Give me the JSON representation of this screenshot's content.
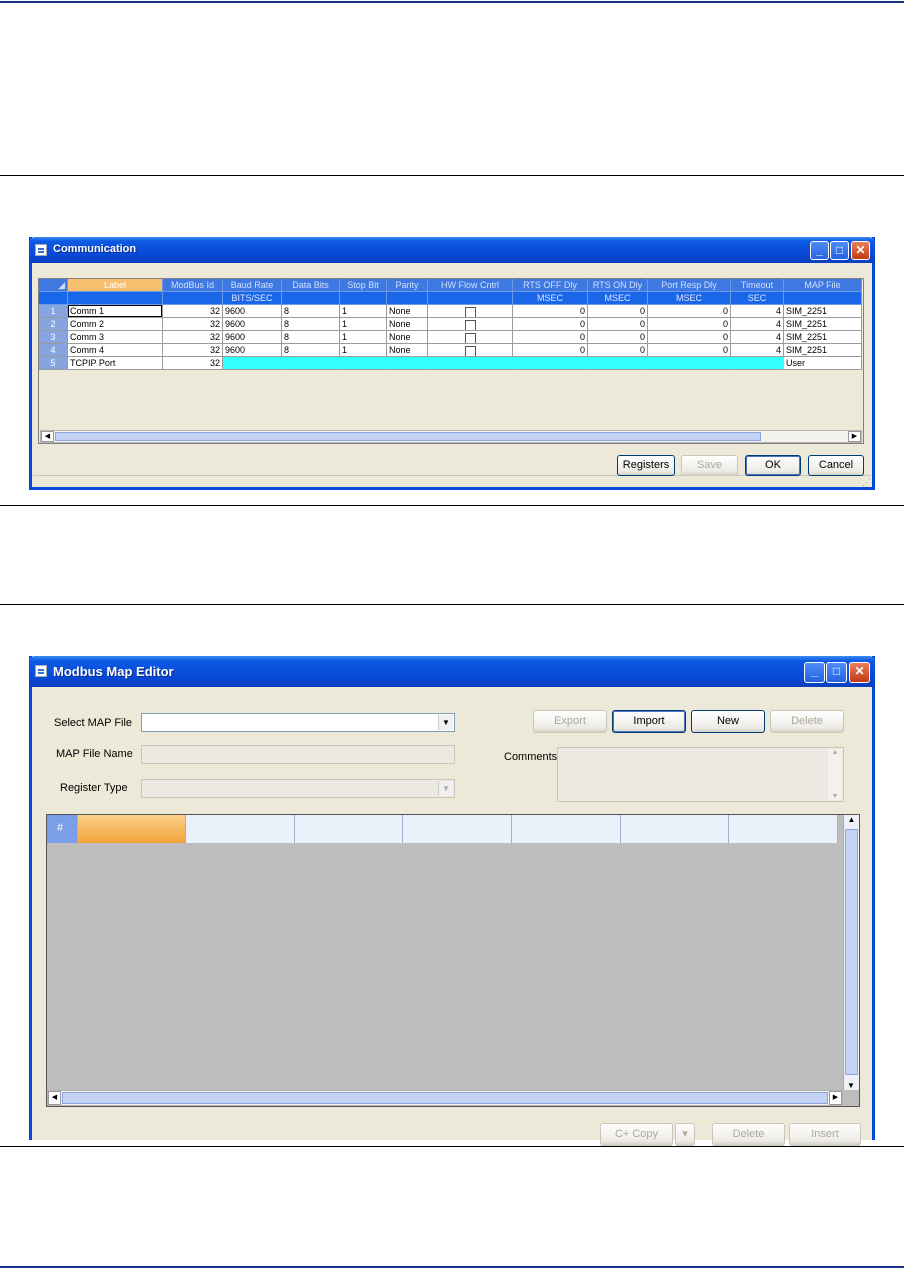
{
  "communication": {
    "title": "Communication",
    "columns": [
      {
        "label": "Label",
        "unit": ""
      },
      {
        "label": "ModBus Id",
        "unit": ""
      },
      {
        "label": "Baud Rate",
        "unit": "BITS/SEC"
      },
      {
        "label": "Data Bits",
        "unit": ""
      },
      {
        "label": "Stop Bit",
        "unit": ""
      },
      {
        "label": "Parity",
        "unit": ""
      },
      {
        "label": "HW Flow Cntrl",
        "unit": ""
      },
      {
        "label": "RTS OFF Dly",
        "unit": "MSEC"
      },
      {
        "label": "RTS ON Dly",
        "unit": "MSEC"
      },
      {
        "label": "Port Resp Dly",
        "unit": "MSEC"
      },
      {
        "label": "Timeout",
        "unit": "SEC"
      },
      {
        "label": "MAP File",
        "unit": ""
      }
    ],
    "rows": [
      {
        "num": "1",
        "label": "Comm 1",
        "modbus_id": "32",
        "baud": "9600",
        "data_bits": "8",
        "stop_bit": "1",
        "parity": "None",
        "hw_flow": false,
        "rts_off": "0",
        "rts_on": "0",
        "port_resp": "0",
        "timeout": "4",
        "map_file": "SIM_2251"
      },
      {
        "num": "2",
        "label": "Comm 2",
        "modbus_id": "32",
        "baud": "9600",
        "data_bits": "8",
        "stop_bit": "1",
        "parity": "None",
        "hw_flow": false,
        "rts_off": "0",
        "rts_on": "0",
        "port_resp": "0",
        "timeout": "4",
        "map_file": "SIM_2251"
      },
      {
        "num": "3",
        "label": "Comm 3",
        "modbus_id": "32",
        "baud": "9600",
        "data_bits": "8",
        "stop_bit": "1",
        "parity": "None",
        "hw_flow": false,
        "rts_off": "0",
        "rts_on": "0",
        "port_resp": "0",
        "timeout": "4",
        "map_file": "SIM_2251"
      },
      {
        "num": "4",
        "label": "Comm 4",
        "modbus_id": "32",
        "baud": "9600",
        "data_bits": "8",
        "stop_bit": "1",
        "parity": "None",
        "hw_flow": false,
        "rts_off": "0",
        "rts_on": "0",
        "port_resp": "0",
        "timeout": "4",
        "map_file": "SIM_2251"
      },
      {
        "num": "5",
        "label": "TCPIP Port",
        "modbus_id": "32",
        "baud": "",
        "data_bits": "",
        "stop_bit": "",
        "parity": "",
        "hw_flow": null,
        "rts_off": "",
        "rts_on": "",
        "port_resp": "",
        "timeout": "",
        "map_file": "User"
      }
    ],
    "buttons": {
      "registers": "Registers",
      "save": "Save",
      "ok": "OK",
      "cancel": "Cancel"
    }
  },
  "modbus": {
    "title": "Modbus Map Editor",
    "select_map_file_label": "Select MAP File",
    "map_file_name_label": "MAP File Name",
    "register_type_label": "Register Type",
    "comments_label": "Comments",
    "buttons": {
      "export": "Export",
      "import": "Import",
      "new": "New",
      "delete": "Delete",
      "copy": "C+ Copy",
      "delete2": "Delete",
      "insert": "Insert"
    },
    "grid_corner": "#"
  },
  "icons": {
    "minimize": "minimize-icon",
    "maximize": "maximize-icon",
    "close": "close-icon"
  }
}
